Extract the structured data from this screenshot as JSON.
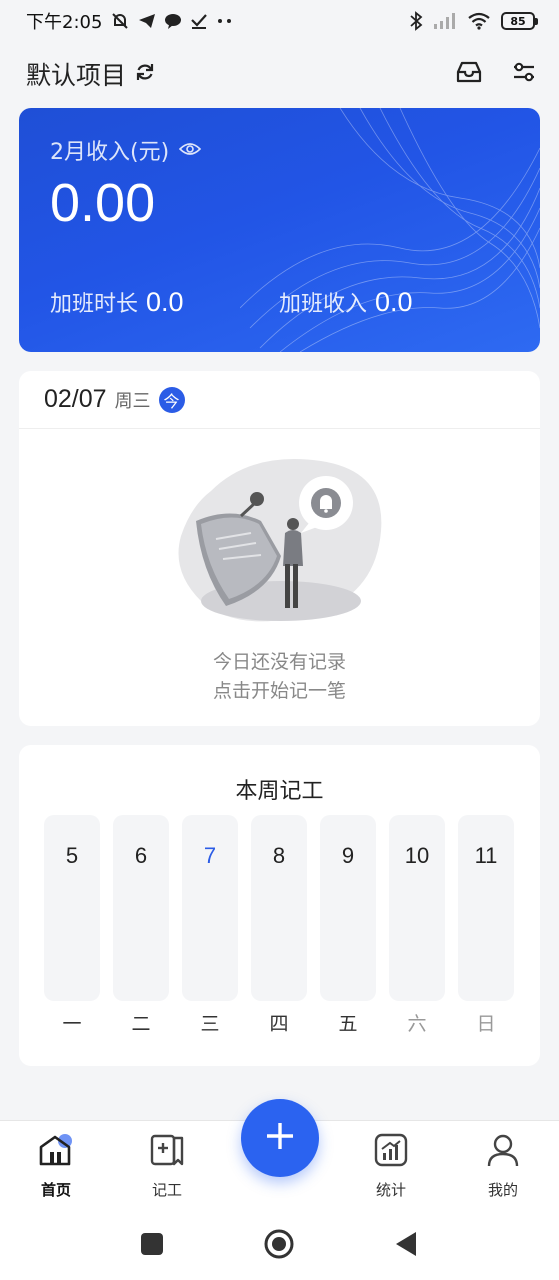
{
  "status_bar": {
    "time": "下午2:05",
    "battery": "85"
  },
  "header": {
    "project_title": "默认项目",
    "icons": [
      "refresh-icon",
      "inbox-icon",
      "settings-sliders-icon"
    ]
  },
  "income_card": {
    "label": "2月收入(元)",
    "amount": "0.00",
    "overtime_hours_label": "加班时长",
    "overtime_hours_value": "0.0",
    "overtime_income_label": "加班收入",
    "overtime_income_value": "0.0",
    "accent_color": "#2255e6"
  },
  "today": {
    "date": "02/07",
    "weekday": "周三",
    "badge": "今",
    "empty_line1": "今日还没有记录",
    "empty_line2": "点击开始记一笔"
  },
  "week": {
    "title": "本周记工",
    "days": [
      {
        "num": "5",
        "label": "一"
      },
      {
        "num": "6",
        "label": "二"
      },
      {
        "num": "7",
        "label": "三"
      },
      {
        "num": "8",
        "label": "四"
      },
      {
        "num": "9",
        "label": "五"
      },
      {
        "num": "10",
        "label": "六"
      },
      {
        "num": "11",
        "label": "日"
      }
    ]
  },
  "bottom_nav": {
    "home": "首页",
    "record": "记工",
    "stats": "统计",
    "mine": "我的"
  }
}
